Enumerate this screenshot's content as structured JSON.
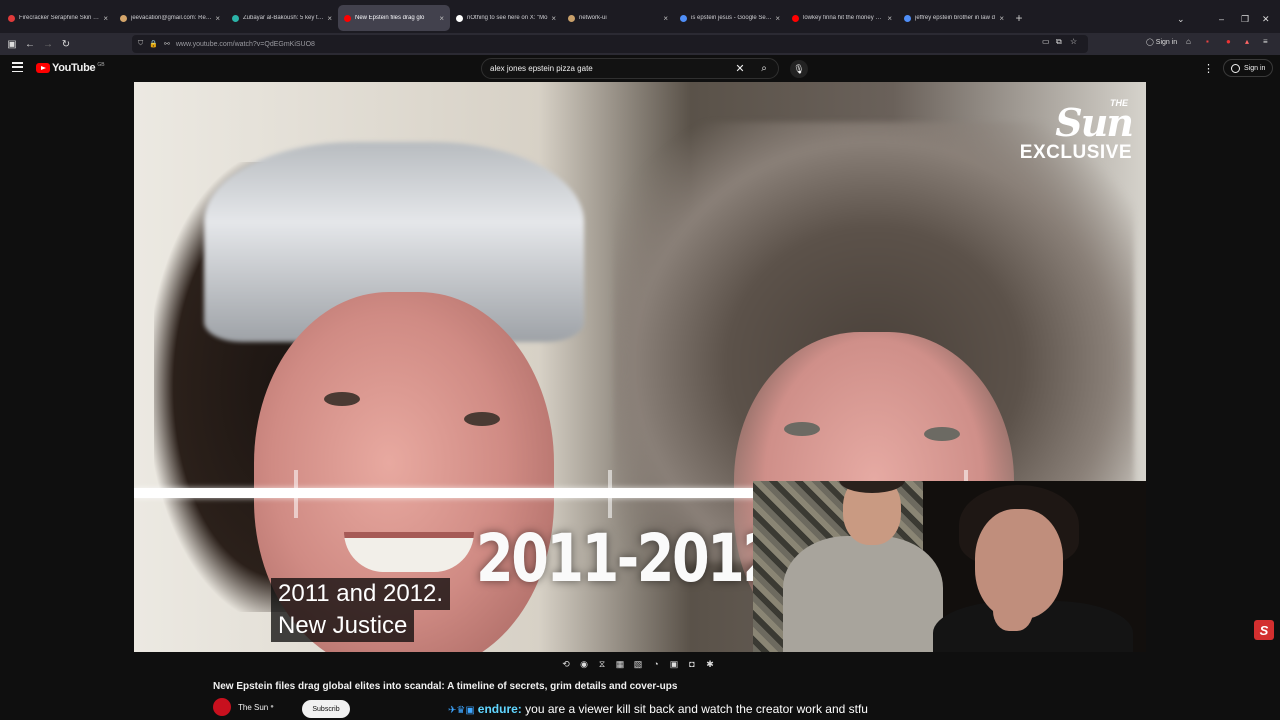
{
  "browser": {
    "tabs": [
      {
        "title": "Firecracker Seraphine Skin Spo",
        "favicon_color": "#e03a3a",
        "active": false
      },
      {
        "title": "jeevacation@gmail.com: Re: —",
        "favicon_color": "#d4a56a",
        "active": false
      },
      {
        "title": "Zubayar al-Bakoush: 5 key thing",
        "favicon_color": "#2bb3a8",
        "active": false
      },
      {
        "title": "New Epstein files drag glo",
        "favicon_color": "#ff0000",
        "active": true
      },
      {
        "title": "nOthing to see here on X: \"Mo",
        "favicon_color": "#ffffff",
        "active": false
      },
      {
        "title": "network-ui",
        "favicon_color": "#c9a06a",
        "active": false
      },
      {
        "title": "is epstein jesus - Google Search",
        "favicon_color": "#4f8ef7",
        "active": false
      },
      {
        "title": "lowkey finna hit the money spo",
        "favicon_color": "#ff0000",
        "active": false
      },
      {
        "title": "jeffrey epstein brother in law d",
        "favicon_color": "#4f8ef7",
        "active": false
      }
    ],
    "new_tab_label": "+",
    "close_tab_label": "×",
    "url": {
      "host": "www.youtube.com",
      "path": "/watch?v=QdEGmKiSUO8"
    },
    "signin_label": "Sign in"
  },
  "youtube": {
    "logo_text": "YouTube",
    "region": "GB",
    "search_query": "alex jones epstein pizza gate",
    "signin_label": "Sign in"
  },
  "video": {
    "brand_the": "THE",
    "brand_sun": "Sun",
    "brand_exclusive": "EXCLUSIVE",
    "overlay_year": "2011-2012",
    "captions": [
      "2011 and 2012.",
      "New Justice"
    ],
    "title": "New Epstein files drag global elites into scandal: A timeline of secrets, grim details and cover-ups",
    "channel": "The Sun",
    "subscribe_label": "Subscrib"
  },
  "chat_message": {
    "username": "endure:",
    "text": "you are a viewer kill sit back and watch the creator work and stfu"
  },
  "corner_badge": "S"
}
